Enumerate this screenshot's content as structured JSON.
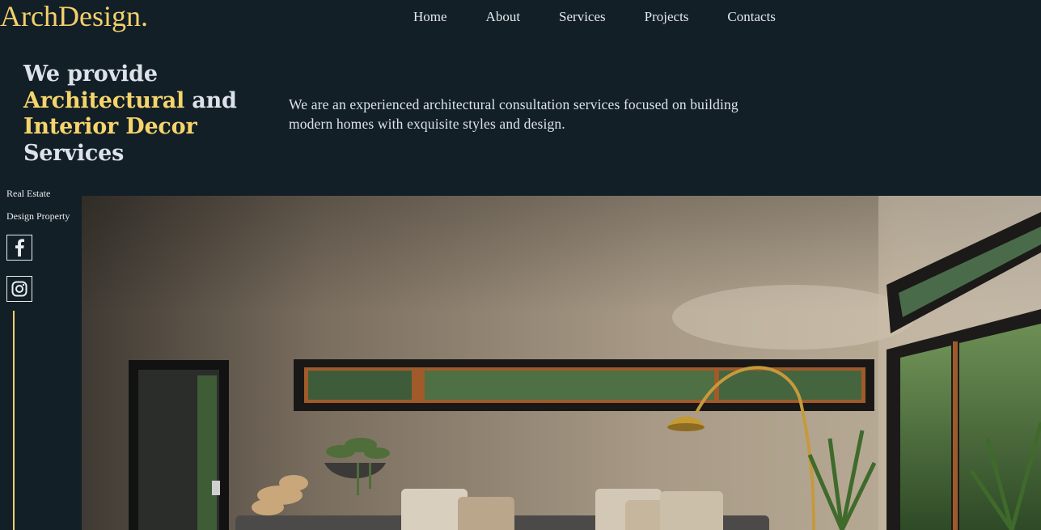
{
  "header": {
    "logo": "ArchDesign.",
    "nav": [
      "Home",
      "About",
      "Services",
      "Projects",
      "Contacts"
    ]
  },
  "hero": {
    "title_line1": "We provide",
    "title_hl1": "Architectural",
    "title_and": " and",
    "title_hl2": "Interior Decor",
    "title_line4": "Services",
    "description": "We are an experienced architectural consultation services focused on building modern homes with exquisite styles and design."
  },
  "sidebar": {
    "links": [
      "Real Estate",
      "Design Property"
    ],
    "social_icons": [
      "facebook-icon",
      "instagram-icon"
    ]
  },
  "colors": {
    "background": "#131f27",
    "accent": "#f2d06b",
    "text": "#dde2ea"
  }
}
